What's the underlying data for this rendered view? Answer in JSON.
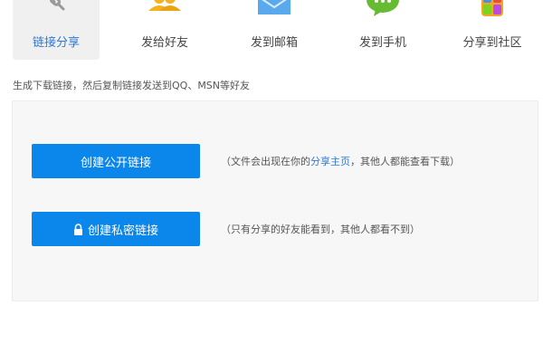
{
  "tabs": [
    {
      "label": "链接分享",
      "icon": "link-icon",
      "active": true
    },
    {
      "label": "发给好友",
      "icon": "friends-icon",
      "active": false
    },
    {
      "label": "发到邮箱",
      "icon": "mail-icon",
      "active": false
    },
    {
      "label": "发到手机",
      "icon": "chat-bubble-icon",
      "active": false
    },
    {
      "label": "分享到社区",
      "icon": "community-icon",
      "active": false
    }
  ],
  "description": "生成下载链接，然后复制链接发送到QQ、MSN等好友",
  "public_link": {
    "button_label": "创建公开链接",
    "note_before": "（文件会出现在你的",
    "note_link": "分享主页",
    "note_after": "，其他人都能查看下载）"
  },
  "private_link": {
    "button_label": "创建私密链接",
    "icon": "lock-icon",
    "note": "（只有分享的好友能看到，其他人都看不到）"
  },
  "colors": {
    "accent": "#0b86ea",
    "link_text": "#2c7ad6",
    "panel_bg": "#f7f7f7",
    "active_tab_bg": "#f0f0f0"
  }
}
